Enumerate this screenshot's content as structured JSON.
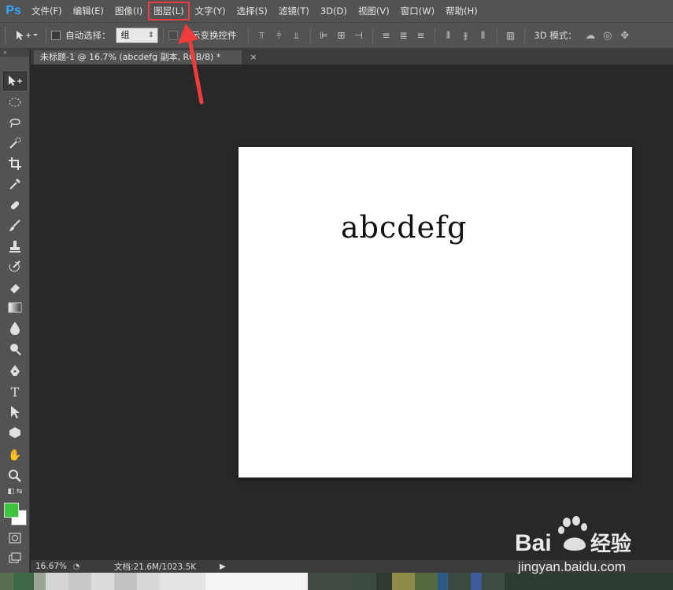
{
  "app": {
    "logo": "Ps"
  },
  "menu": [
    {
      "label": "文件(F)"
    },
    {
      "label": "编辑(E)"
    },
    {
      "label": "图像(I)"
    },
    {
      "label": "图层(L)",
      "highlighted": true
    },
    {
      "label": "文字(Y)"
    },
    {
      "label": "选择(S)"
    },
    {
      "label": "滤镜(T)"
    },
    {
      "label": "3D(D)"
    },
    {
      "label": "视图(V)"
    },
    {
      "label": "窗口(W)"
    },
    {
      "label": "帮助(H)"
    }
  ],
  "options": {
    "auto_select_label": "自动选择：",
    "auto_select_checked": false,
    "auto_select_value": "组",
    "show_transform_label": "显示变换控件",
    "mode_label": "3D 模式："
  },
  "document": {
    "tab_title": "未标题-1 @ 16.7% (abcdefg 副本, RGB/8) *",
    "tab_close": "×",
    "canvas_text": "abcdefg"
  },
  "status": {
    "zoom": "16.67%",
    "doc_info": "文档:21.6M/1023.5K"
  },
  "colors": {
    "accent_highlight": "#f03c3c",
    "foreground_color": "#3cc43c",
    "background_color": "#ffffff",
    "ps_logo": "#31a8ff"
  },
  "watermark": {
    "brand": "Baidu经验",
    "url": "jingyan.baidu.com"
  },
  "icons": [
    "move-tool-icon",
    "marquee-icon",
    "lasso-icon",
    "quick-select-icon",
    "crop-icon",
    "eyedropper-icon",
    "healing-brush-icon",
    "brush-icon",
    "clone-stamp-icon",
    "history-brush-icon",
    "eraser-icon",
    "gradient-icon",
    "blur-icon",
    "dodge-icon",
    "pen-icon",
    "type-icon",
    "path-select-icon",
    "shape-icon",
    "hand-icon",
    "zoom-icon"
  ]
}
